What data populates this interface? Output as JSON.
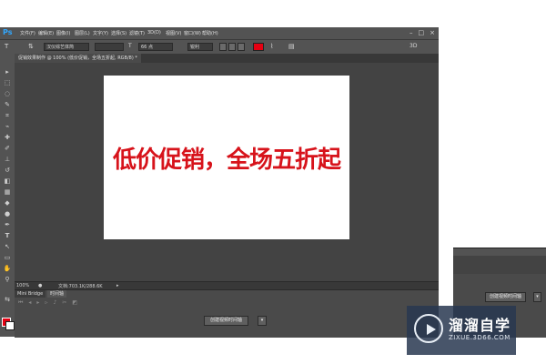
{
  "app": {
    "logo": "Ps"
  },
  "menubar": {
    "items": [
      "文件(F)",
      "编辑(E)",
      "图像(I)",
      "图层(L)",
      "文字(Y)",
      "选择(S)",
      "滤镜(T)",
      "3D(D)",
      "视图(V)",
      "窗口(W)",
      "帮助(H)"
    ]
  },
  "options": {
    "tool_icon": "T",
    "font_family": "汉仪综艺体简",
    "font_size": "66 点",
    "antialias": "锐利",
    "text_color": "#e60012",
    "mode_3d": "3D"
  },
  "document": {
    "tab_label": "促销效果制作 @ 100% (低价促销，全场五折起, RGB/8) *",
    "canvas_text": "低价促销，全场五折起",
    "canvas_text_color": "#d7131b"
  },
  "status": {
    "zoom": "100%",
    "doc_info": "文档:703.1K/288.6K"
  },
  "timeline_panel": {
    "tab_minibridge": "Mini Bridge",
    "tab_timeline": "时间轴",
    "create_button": "创建视频时间轴"
  },
  "second_window": {
    "create_button": "创建视频时间轴"
  },
  "watermark": {
    "title": "溜溜自学",
    "url": "ZIXUE.3D66.COM"
  }
}
